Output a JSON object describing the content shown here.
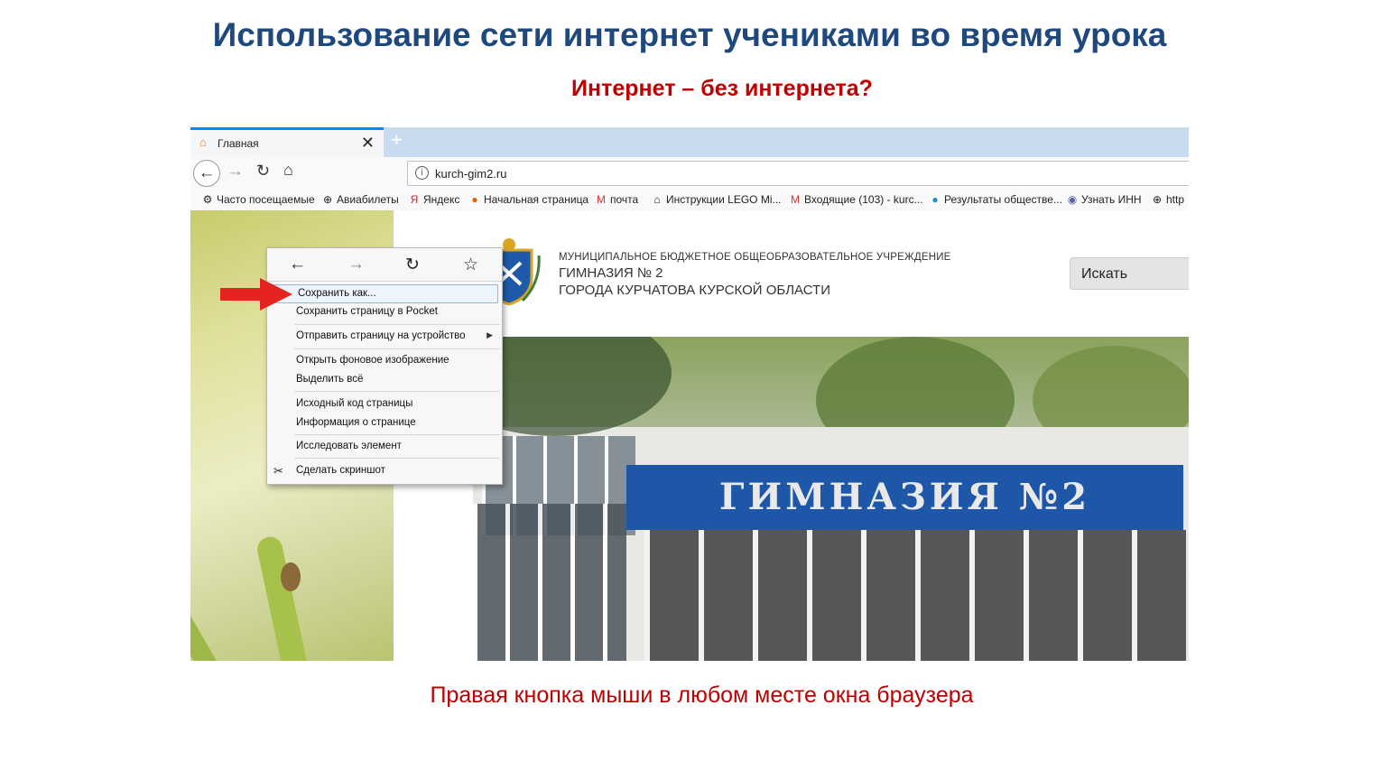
{
  "slide": {
    "title": "Использование сети интернет учениками во время урока",
    "subtitle": "Интернет – без интернета?",
    "caption": "Правая кнопка мыши в любом месте окна браузера"
  },
  "browser": {
    "tab": {
      "title": "Главная",
      "close": "✕",
      "icon": "home-icon"
    },
    "new_tab": "+",
    "nav": {
      "back": "←",
      "forward": "→",
      "reload": "↻",
      "home": "⌂"
    },
    "url": "kurch-gim2.ru",
    "bookmarks": [
      {
        "label": "Часто посещаемые",
        "icon": "⚙"
      },
      {
        "label": "Авиабилеты",
        "icon": "⊕"
      },
      {
        "label": "Яндекс",
        "icon": "Я"
      },
      {
        "label": "Начальная страница",
        "icon": "●"
      },
      {
        "label": "почта",
        "icon": "M"
      },
      {
        "label": "Инструкции LEGO Mi...",
        "icon": "⌂"
      },
      {
        "label": "Входящие (103) - kurc...",
        "icon": "M"
      },
      {
        "label": "Результаты обществе...",
        "icon": "●"
      },
      {
        "label": "Узнать ИНН",
        "icon": "◉"
      },
      {
        "label": "http",
        "icon": "⊕"
      }
    ]
  },
  "website": {
    "org_line1": "МУНИЦИПАЛЬНОЕ БЮДЖЕТНОЕ ОБЩЕОБРАЗОВАТЕЛЬНОЕ УЧРЕЖДЕНИЕ",
    "org_line2": "ГИМНАЗИЯ № 2",
    "org_line3": "ГОРОДА КУРЧАТОВА КУРСКОЙ ОБЛАСТИ",
    "search_label": "Искать",
    "photo_sign": "ГИМНАЗИЯ №2"
  },
  "context_menu": {
    "nav": {
      "back": "←",
      "forward": "→",
      "reload": "↻",
      "bookmark": "☆"
    },
    "items": [
      "Сохранить как...",
      "Сохранить страницу в Pocket",
      "Отправить страницу на устройство",
      "Открыть фоновое изображение",
      "Выделить всё",
      "Исходный код страницы",
      "Информация о странице",
      "Исследовать элемент",
      "Сделать скриншот"
    ],
    "submenu_arrow": "▶",
    "screenshot_icon": "✂"
  },
  "colors": {
    "title": "#1f497d",
    "accent_red": "#c00000",
    "sign_blue": "#1f57a8",
    "tab_accent": "#0a84ff"
  }
}
